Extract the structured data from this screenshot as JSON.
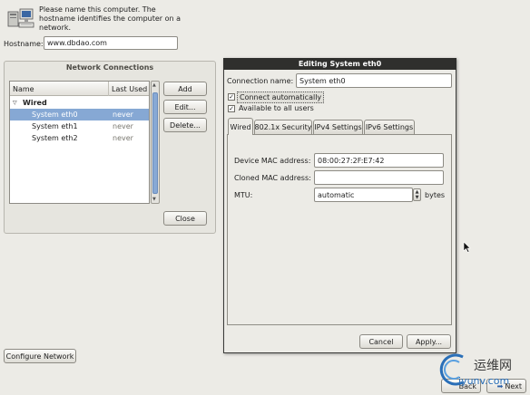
{
  "intro": {
    "lines": [
      "Please name this computer.  The",
      "hostname identifies the computer on a",
      "network."
    ]
  },
  "hostname": {
    "label": "Hostname:",
    "value": "www.dbdao.com"
  },
  "network_connections": {
    "title": "Network Connections",
    "columns": [
      "Name",
      "Last Used"
    ],
    "group": "Wired",
    "rows": [
      {
        "name": "System eth0",
        "last_used": "never",
        "selected": true
      },
      {
        "name": "System eth1",
        "last_used": "never",
        "selected": false
      },
      {
        "name": "System eth2",
        "last_used": "never",
        "selected": false
      }
    ],
    "buttons": {
      "add": "Add",
      "edit": "Edit...",
      "delete": "Delete...",
      "close": "Close"
    }
  },
  "configure_network": {
    "label": "Configure Network"
  },
  "dialog": {
    "title": "Editing System eth0",
    "connection_name_label": "Connection name:",
    "connection_name_value": "System eth0",
    "connect_automatically": {
      "label": "Connect automatically",
      "checked": true
    },
    "available_to_all": {
      "label": "Available to all users",
      "checked": true
    },
    "tabs": [
      "Wired",
      "802.1x Security",
      "IPv4 Settings",
      "IPv6 Settings"
    ],
    "active_tab": "Wired",
    "device_mac_label": "Device MAC address:",
    "device_mac_value": "08:00:27:2F:E7:42",
    "cloned_mac_label": "Cloned MAC address:",
    "cloned_mac_value": "",
    "mtu_label": "MTU:",
    "mtu_value": "automatic",
    "mtu_unit": "bytes",
    "cancel": "Cancel",
    "apply": "Apply..."
  },
  "nav": {
    "back": "Back",
    "next": "Next"
  },
  "watermark": {
    "text": "运维网",
    "sub": "iyunv.com"
  },
  "colors": {
    "selection": "#86a8d4",
    "title_bar": "#2f2f2d",
    "background": "#ecebe6"
  }
}
